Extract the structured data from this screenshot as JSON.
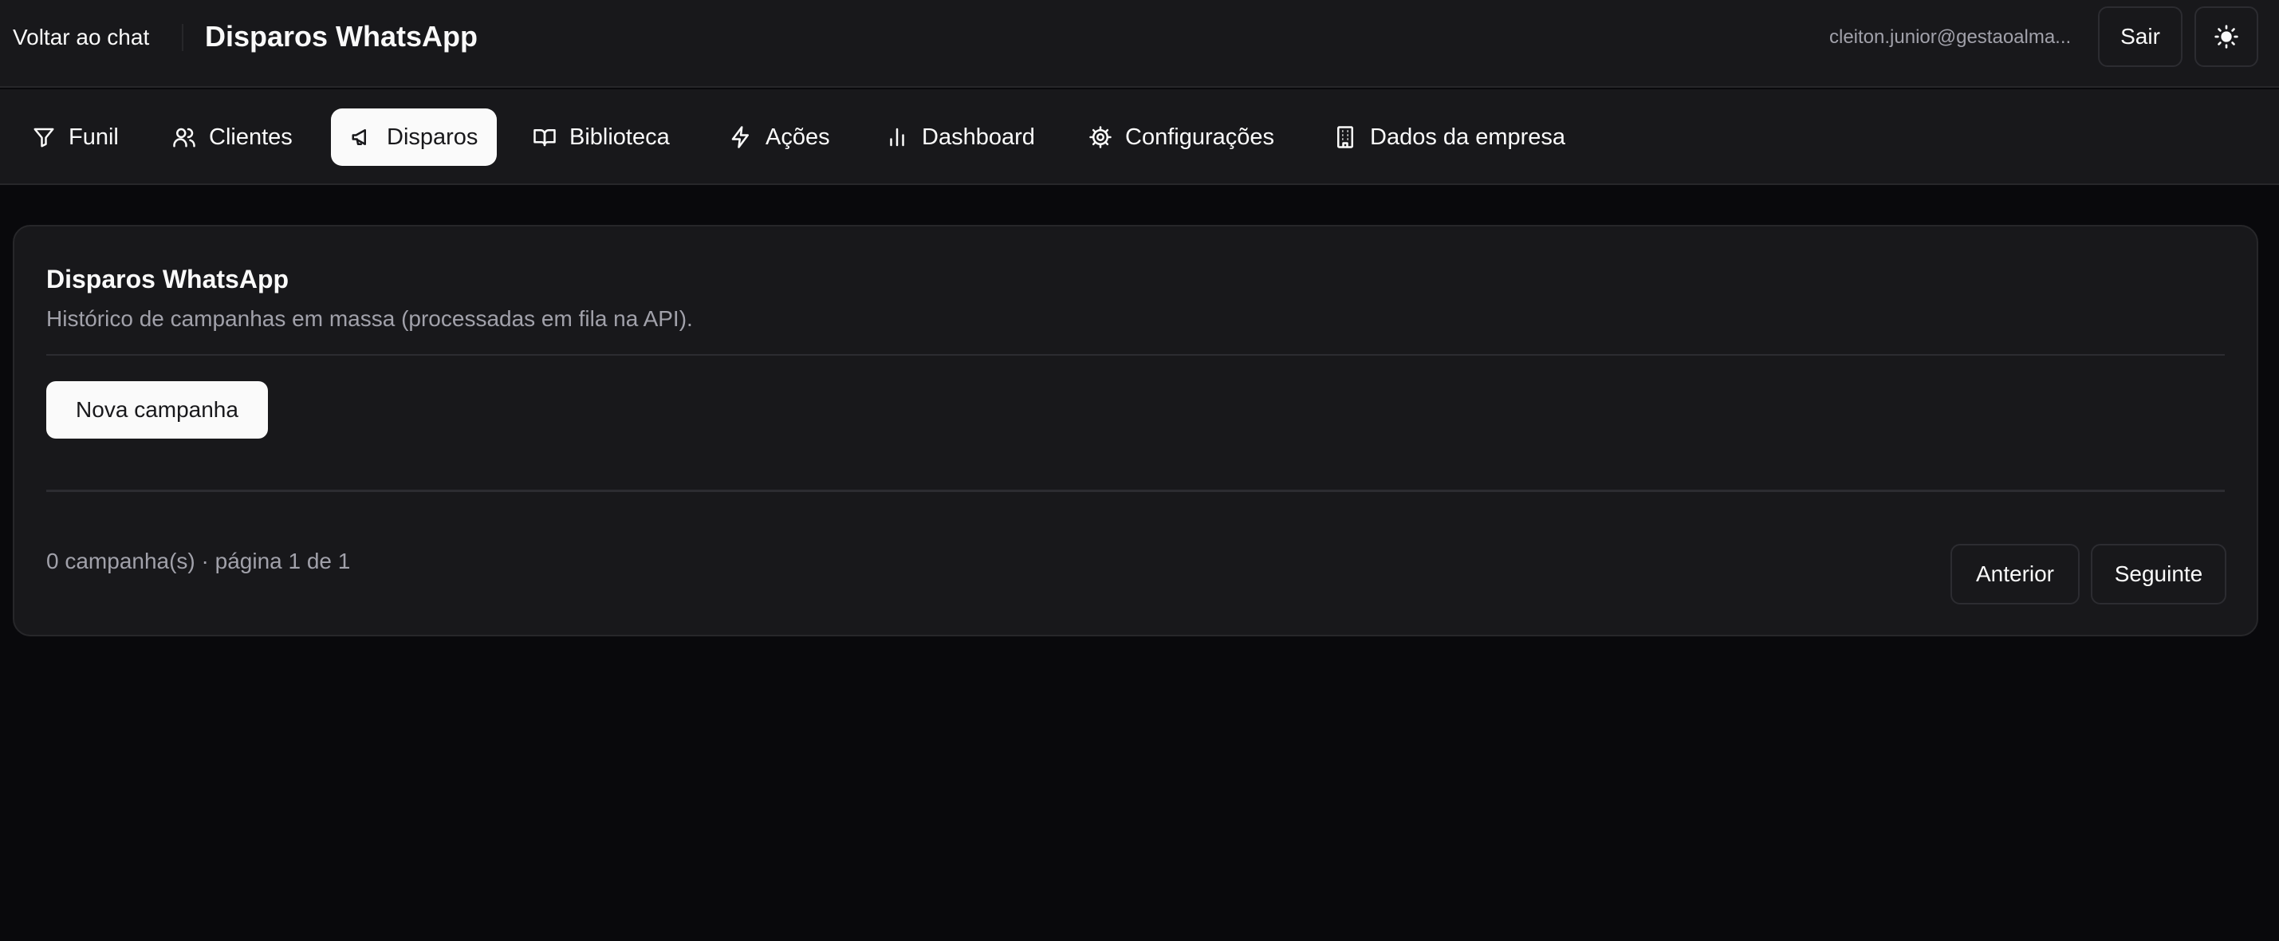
{
  "header": {
    "back_label": "Voltar ao chat",
    "title": "Disparos WhatsApp",
    "user_email": "cleiton.junior@gestaoalma...",
    "logout_label": "Sair",
    "theme_icon": "sun-icon"
  },
  "nav": {
    "active": "Disparos",
    "tabs": [
      {
        "label": "Funil",
        "icon": "filter-icon"
      },
      {
        "label": "Clientes",
        "icon": "users-icon"
      },
      {
        "label": "Disparos",
        "icon": "megaphone-icon"
      },
      {
        "label": "Biblioteca",
        "icon": "book-icon"
      },
      {
        "label": "Ações",
        "icon": "zap-icon"
      },
      {
        "label": "Dashboard",
        "icon": "bar-chart-icon"
      },
      {
        "label": "Configurações",
        "icon": "gear-icon"
      },
      {
        "label": "Dados da empresa",
        "icon": "building-icon"
      }
    ]
  },
  "card": {
    "title": "Disparos WhatsApp",
    "description": "Histórico de campanhas em massa (processadas em fila na API).",
    "new_campaign_label": "Nova campanha",
    "pagination": {
      "summary": "0 campanha(s) · página 1 de 1",
      "prev_label": "Anterior",
      "next_label": "Seguinte"
    }
  },
  "colors": {
    "background": "#09090c",
    "surface": "#18181b",
    "border": "#27272a",
    "text": "#fafafa",
    "muted_text": "#a1a1aa",
    "active_tab_bg": "#fafafa"
  }
}
